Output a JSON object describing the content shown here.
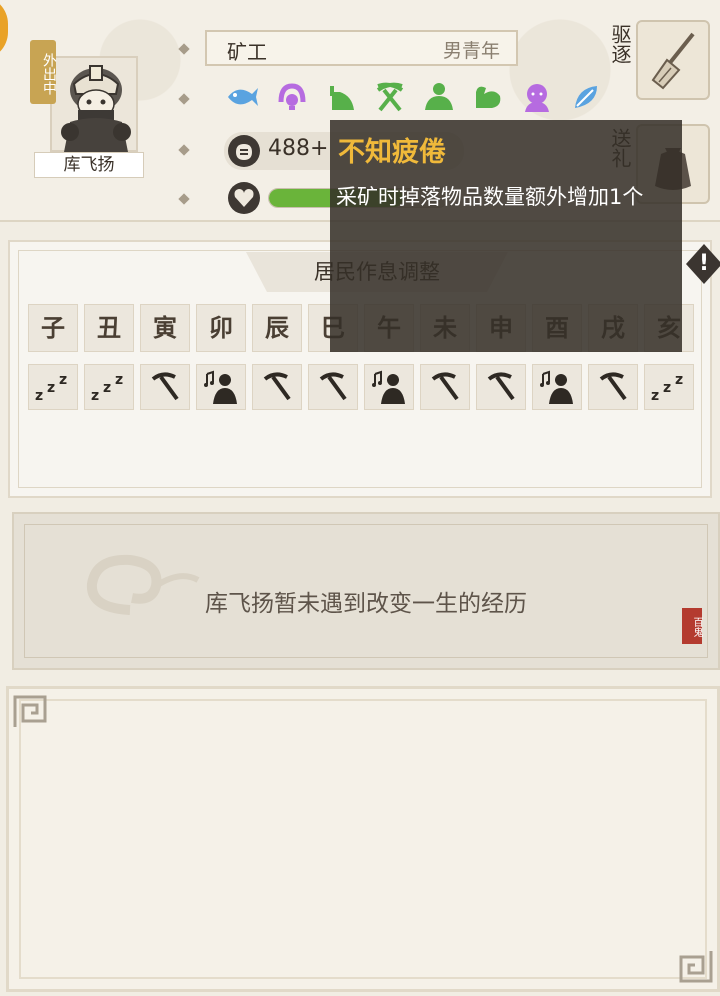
{
  "resident": {
    "name": "库飞扬",
    "status_badge": "外出中",
    "job": "矿工",
    "info": "男青年",
    "stat_text": "488+",
    "health_fraction": 0.75
  },
  "traits": [
    {
      "icon": "fish-trait-icon"
    },
    {
      "icon": "lantern-trait-icon"
    },
    {
      "icon": "fruit-trait-icon"
    },
    {
      "icon": "pickaxe-trait-icon"
    },
    {
      "icon": "meditation-trait-icon"
    },
    {
      "icon": "muscle-trait-icon"
    },
    {
      "icon": "monk-trait-icon"
    },
    {
      "icon": "leaf-trait-icon"
    }
  ],
  "actions": {
    "expel_label": "驱逐",
    "gift_label": "送礼"
  },
  "tooltip": {
    "title": "不知疲倦",
    "body": "采矿时掉落物品数量额外增加1个"
  },
  "schedule": {
    "title": "居民作息调整",
    "hours": [
      "子",
      "丑",
      "寅",
      "卯",
      "辰",
      "巳",
      "午",
      "未",
      "申",
      "酉",
      "戌",
      "亥"
    ],
    "activities": [
      "sleep",
      "sleep",
      "mine",
      "leisure",
      "mine",
      "mine",
      "leisure",
      "mine",
      "mine",
      "leisure",
      "mine",
      "sleep"
    ]
  },
  "experience": {
    "text": "库飞扬暂未遇到改变一生的经历",
    "seal": "百鬼"
  },
  "colors": {
    "accent_gold": "#f0b93a",
    "health_green": "#6ab43a",
    "trait_blue": "#5aa3e0",
    "trait_purple": "#b66be0",
    "trait_green": "#57b04a"
  }
}
